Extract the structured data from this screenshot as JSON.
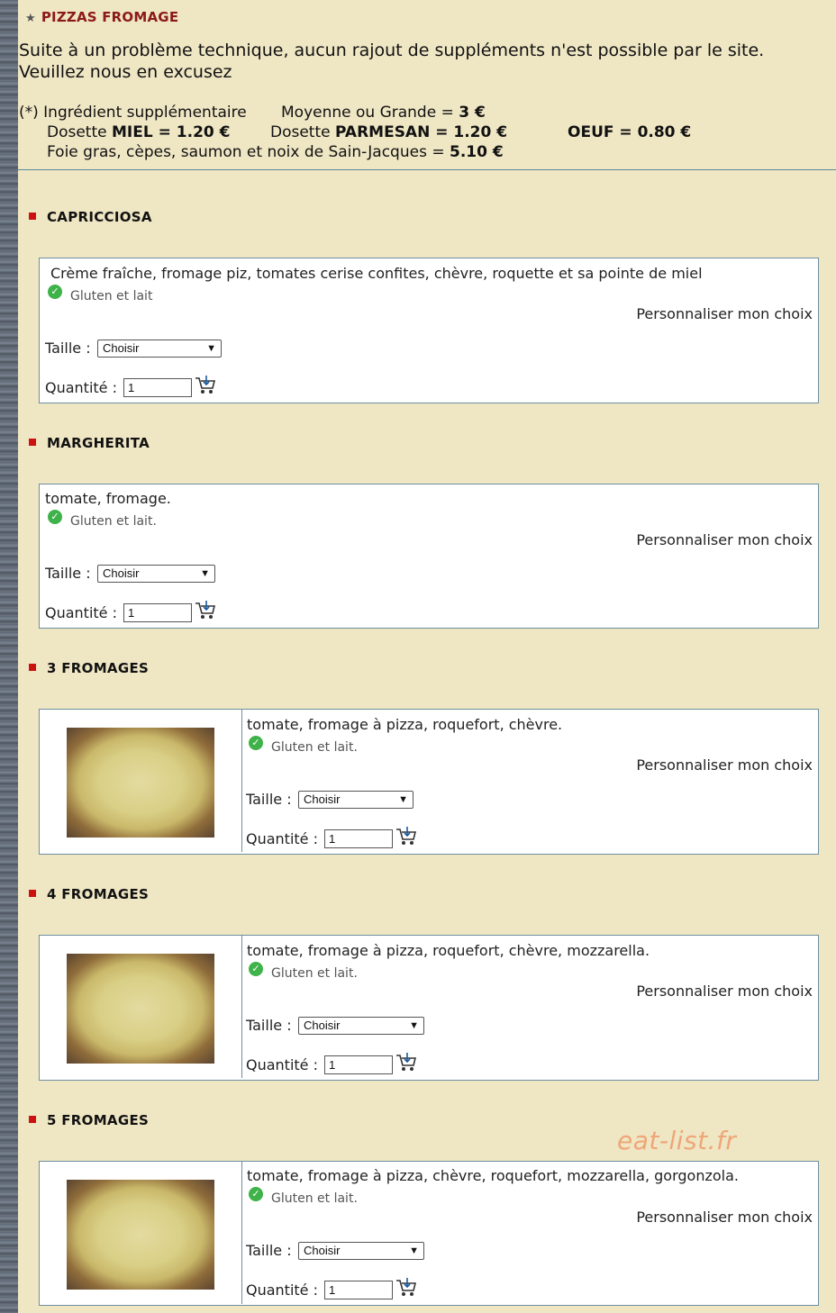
{
  "category": {
    "title": "PIZZAS FROMAGE"
  },
  "notice": {
    "line1": "Suite à un problème technique, aucun rajout de suppléments n'est possible par le site.",
    "line2": "Veuillez nous en excusez"
  },
  "extras": {
    "l1a": "(*) Ingrédient supplémentaire",
    "l1b": "Moyenne ou Grande = ",
    "l1b_price": "3 €",
    "l2a_pre": "Dosette ",
    "l2a_name": "MIEL = 1.20 €",
    "l2b_pre": "Dosette ",
    "l2b_name": "PARMESAN = 1.20 €",
    "l2c": "OEUF = 0.80 €",
    "l3": "Foie gras, cèpes, saumon et noix de Sain-Jacques = ",
    "l3_price": "5.10 €"
  },
  "labels": {
    "perso": "Personnaliser mon choix",
    "taille": "Taille :",
    "quantite": "Quantité :",
    "select_default": "Choisir",
    "qty_default": "1"
  },
  "items": [
    {
      "name": "CAPRICCIOSA",
      "desc": "Crème fraîche, fromage piz, tomates cerise confites, chèvre, roquette et sa pointe de miel",
      "allergen": "Gluten et lait"
    },
    {
      "name": "MARGHERITA",
      "desc": "tomate, fromage.",
      "allergen": "Gluten et lait."
    },
    {
      "name": "3 FROMAGES",
      "desc": "tomate, fromage à pizza, roquefort, chèvre.",
      "allergen": "Gluten et lait."
    },
    {
      "name": "4 FROMAGES",
      "desc": "tomate, fromage à pizza, roquefort, chèvre, mozzarella.",
      "allergen": "Gluten et lait."
    },
    {
      "name": "5 FROMAGES",
      "desc": "tomate, fromage à pizza, chèvre, roquefort, mozzarella, gorgonzola.",
      "allergen": "Gluten et lait."
    }
  ],
  "watermark": "eat-list.fr",
  "colors": {
    "category_title": "#8b1a1a",
    "bullet": "#cc1111",
    "check": "#3fb24a",
    "card_border": "#6d8fa0",
    "background": "#efe6c4"
  },
  "icons": {
    "star": "star-icon",
    "check": "check-circle-icon",
    "cart": "add-to-cart-icon",
    "chevron": "chevron-down-icon"
  }
}
